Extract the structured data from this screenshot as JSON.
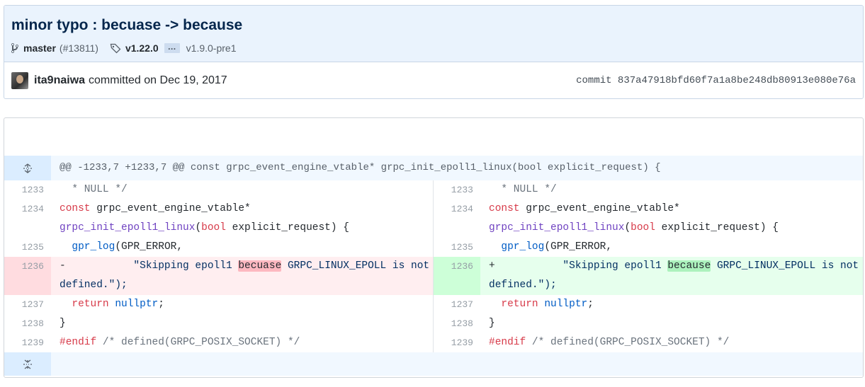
{
  "commit": {
    "title": "minor typo : becuase -> because",
    "branch": "master",
    "pr": "(#13811)",
    "tag_first": "v1.22.0",
    "tag_more": "…",
    "tag_last": "v1.9.0-pre1",
    "author": "ita9naiwa",
    "committed_text": "committed on Dec 19, 2017",
    "sha_text": "commit 837a47918bfd60f7a1a8be248db80913e080e76a"
  },
  "diff": {
    "hunk_header": "@@ -1233,7 +1233,7 @@ const grpc_event_engine_vtable* grpc_init_epoll1_linux(bool explicit_request) {",
    "lines": {
      "n1233": "1233",
      "n1234": "1234",
      "n1235": "1235",
      "n1236": "1236",
      "n1237": "1237",
      "n1238": "1238",
      "n1239": "1239"
    },
    "tokens": {
      "null_comment": "* NULL */",
      "const": "const",
      "vtable_type": "grpc_event_engine_vtable*",
      "init_fn": "grpc_init_epoll1_linux",
      "bool": "bool",
      "param": "explicit_request) {",
      "gpr_log": "gpr_log",
      "gpr_args": "(GPR_ERROR,",
      "minus": "-",
      "plus": "+",
      "str_pre": "\"Skipping epoll1 ",
      "old_word": "becuase",
      "new_word": "because",
      "str_post": " GRPC_LINUX_EPOLL is not defined.\");",
      "return": "return",
      "nullptr": "nullptr",
      "semicolon": ";",
      "brace": "}",
      "hash": "#",
      "endif": "endif",
      "endif_comment": "/* defined(GRPC_POSIX_SOCKET) */"
    }
  },
  "icons": {
    "branch": "git-branch-icon",
    "tag": "tag-icon",
    "expand_up": "unfold-icon",
    "expand_down": "fold-down-icon"
  },
  "colors": {
    "header_bg": "#eaf3fd",
    "deletion_bg": "#ffeef0",
    "addition_bg": "#e6ffed",
    "deleted_word": "#fdb8c0",
    "added_word": "#acf2bd"
  }
}
